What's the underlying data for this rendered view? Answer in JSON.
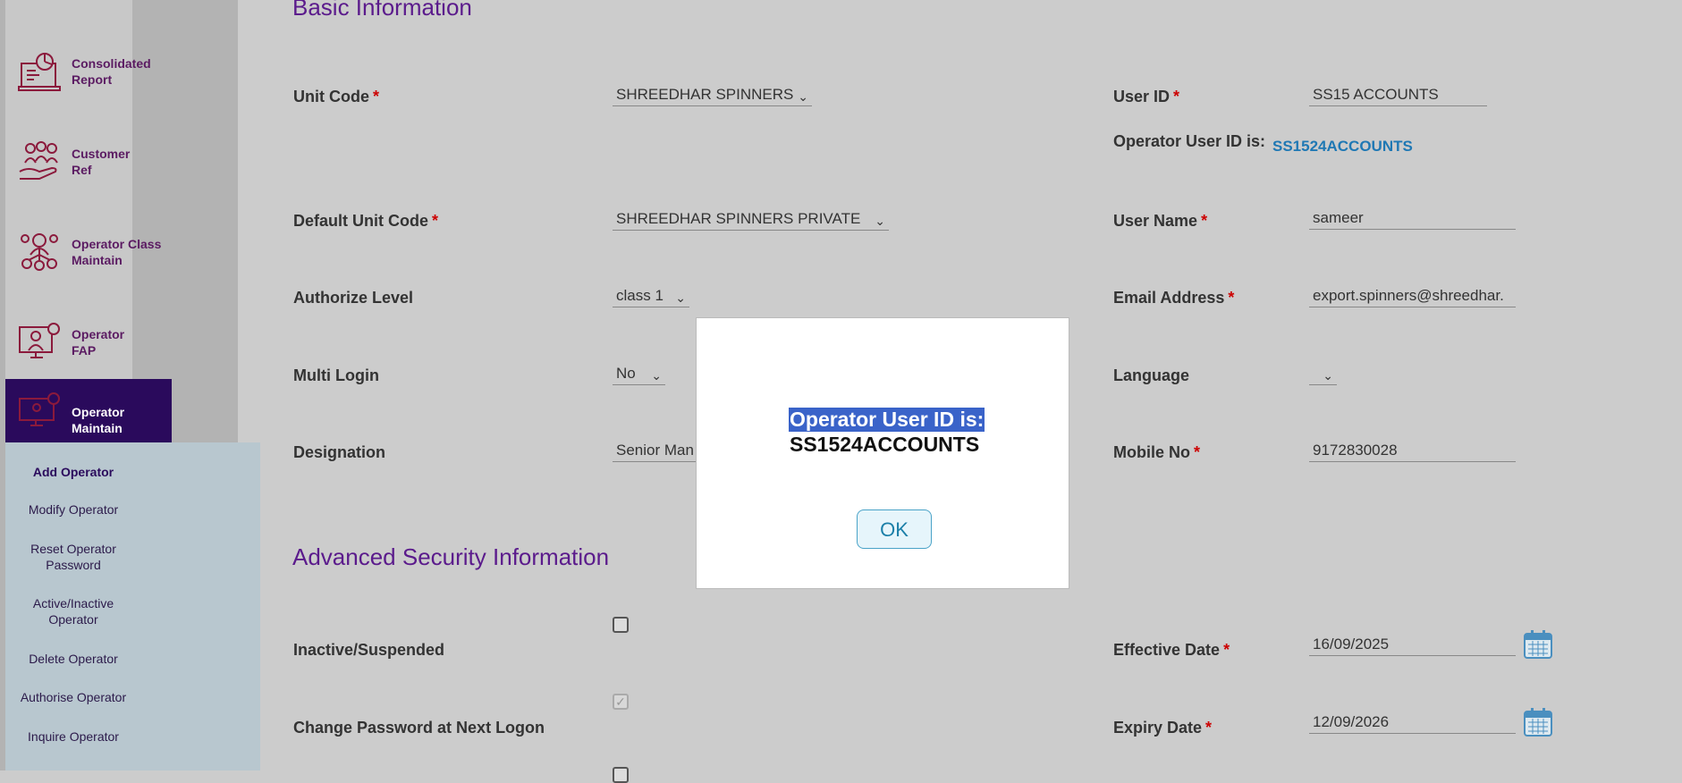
{
  "sidebar": {
    "items": [
      {
        "line1": "Consolidated",
        "line2": "Report"
      },
      {
        "line1": "Customer",
        "line2": "Ref"
      },
      {
        "line1": "Operator Class",
        "line2": "Maintain"
      },
      {
        "line1": "Operator",
        "line2": "FAP"
      },
      {
        "line1": "Operator",
        "line2": "Maintain"
      }
    ],
    "submenu": [
      {
        "line1": "Add Operator",
        "line2": ""
      },
      {
        "line1": "Modify Operator",
        "line2": ""
      },
      {
        "line1": "Reset Operator",
        "line2": "Password"
      },
      {
        "line1": "Active/Inactive",
        "line2": "Operator"
      },
      {
        "line1": "Delete Operator",
        "line2": ""
      },
      {
        "line1": "Authorise Operator",
        "line2": ""
      },
      {
        "line1": "Inquire Operator",
        "line2": ""
      }
    ]
  },
  "form": {
    "basic_heading": "Basic Information",
    "advanced_heading": "Advanced Security Information",
    "unit_code": {
      "label": "Unit Code",
      "value": "SHREEDHAR SPINNERS"
    },
    "user_id": {
      "label": "User ID",
      "value": "SS15  ACCOUNTS"
    },
    "operator_user_id": {
      "label": "Operator User ID is:",
      "value": "SS1524ACCOUNTS"
    },
    "default_unit_code": {
      "label": "Default Unit Code",
      "value": "SHREEDHAR SPINNERS PRIVATE"
    },
    "user_name": {
      "label": "User Name",
      "value": "sameer"
    },
    "authorize_level": {
      "label": "Authorize Level",
      "value": "class 1"
    },
    "email": {
      "label": "Email Address",
      "value": "export.spinners@shreedhar."
    },
    "multi_login": {
      "label": "Multi Login",
      "value": "No"
    },
    "language": {
      "label": "Language",
      "value": ""
    },
    "designation": {
      "label": "Designation",
      "value": "Senior Man"
    },
    "mobile": {
      "label": "Mobile No",
      "value": "9172830028"
    },
    "inactive": {
      "label": "Inactive/Suspended",
      "checked": false
    },
    "change_pwd": {
      "label": "Change Password at Next Logon",
      "checked": true
    },
    "effective_date": {
      "label": "Effective Date",
      "value": "16/09/2025"
    },
    "expiry_date": {
      "label": "Expiry Date",
      "value": "12/09/2026"
    },
    "required_mark": "*"
  },
  "modal": {
    "line1": "Operator User ID is:",
    "line2": "SS1524ACCOUNTS",
    "ok_label": "OK"
  },
  "colors": {
    "accent": "#5b1b8c",
    "active_nav": "#2a0a5c",
    "link_value": "#1f78b4",
    "required": "#cc0000"
  }
}
